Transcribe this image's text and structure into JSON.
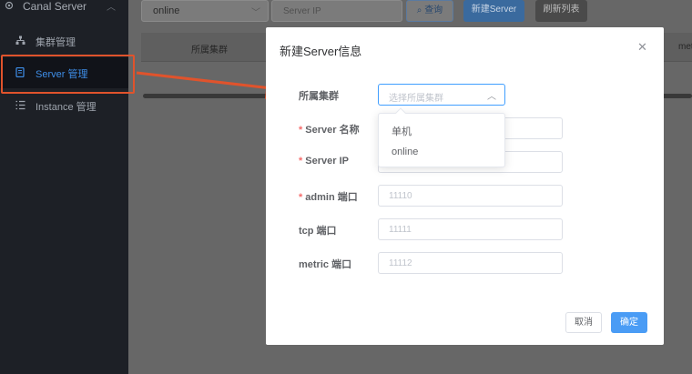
{
  "sidebar": {
    "header": {
      "label": "Canal Server"
    },
    "items": [
      {
        "label": "集群管理",
        "icon": "cluster-icon"
      },
      {
        "label": "Server 管理",
        "icon": "server-icon",
        "active": true
      },
      {
        "label": "Instance 管理",
        "icon": "list-icon"
      }
    ]
  },
  "toolbar": {
    "cluster_select_value": "online",
    "server_ip_placeholder": "Server IP",
    "query_label": "查询",
    "new_server_label": "新建Server",
    "refresh_label": "刷新列表"
  },
  "table": {
    "headers": [
      "所属集群",
      "met"
    ]
  },
  "modal": {
    "title": "新建Server信息",
    "fields": {
      "cluster": {
        "label": "所属集群",
        "placeholder": "选择所属集群"
      },
      "server_name": {
        "label": "Server 名称",
        "required": "*"
      },
      "server_ip": {
        "label": "Server IP",
        "required": "*"
      },
      "admin_port": {
        "label": "admin 端口",
        "required": "*",
        "placeholder": "11110"
      },
      "tcp_port": {
        "label": "tcp 端口",
        "placeholder": "11111"
      },
      "metric_port": {
        "label": "metric 端口",
        "placeholder": "11112"
      }
    },
    "dropdown_options": [
      "单机",
      "online"
    ],
    "cancel_label": "取消",
    "ok_label": "确定"
  },
  "colors": {
    "accent": "#409eff",
    "annotation": "#e0532c",
    "sidebar_bg": "#1d2026"
  }
}
